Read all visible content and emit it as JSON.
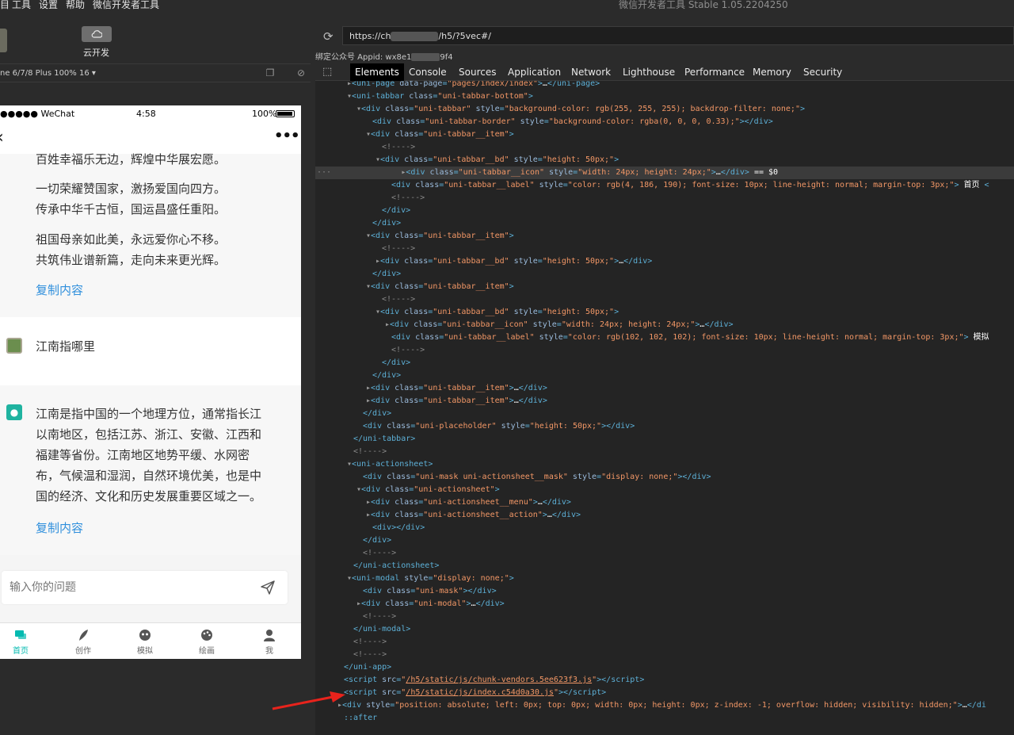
{
  "menubar": {
    "items": [
      "目",
      "工具",
      "设置",
      "帮助",
      "微信开发者工具"
    ],
    "app_title": "微信开发者工具 Stable 1.05.2204250"
  },
  "toolbar": {
    "cloud_label": "云开发"
  },
  "device": {
    "label": "ne 6/7/8 Plus 100% 16 ▾"
  },
  "phone": {
    "status": {
      "signal": "●●●●● WeChat",
      "time": "4:58",
      "battery": "100%"
    },
    "card1": {
      "lines": [
        "百姓幸福乐无边，辉煌中华展宏愿。",
        "一切荣耀赞国家，激扬爱国向四方。",
        "传承中华千古恒，国运昌盛任重阳。",
        "祖国母亲如此美，永远爱你心不移。",
        "共筑伟业谱新篇，走向未来更光辉。"
      ],
      "copy": "复制内容"
    },
    "question": {
      "text": "江南指哪里"
    },
    "answer": {
      "lines": [
        "江南是指中国的一个地理方位，通常指长江",
        "以南地区，包括江苏、浙江、安徽、江西和",
        "福建等省份。江南地区地势平缓、水网密",
        "布，气候温和湿润，自然环境优美，也是中",
        "国的经济、文化和历史发展重要区域之一。"
      ],
      "copy": "复制内容"
    },
    "input": {
      "placeholder": "输入你的问题"
    },
    "tabs": [
      {
        "label": "首页",
        "icon": "chat-icon"
      },
      {
        "label": "创作",
        "icon": "feather-icon"
      },
      {
        "label": "模拟",
        "icon": "mask-icon"
      },
      {
        "label": "绘画",
        "icon": "palette-icon"
      },
      {
        "label": "我",
        "icon": "user-icon"
      }
    ],
    "accent": "#04bab0"
  },
  "devtools": {
    "url_prefix": "https://ch",
    "url_suffix": "/h5/?5vec#/",
    "appid_prefix": "绑定公众号 Appid: wx8e1",
    "appid_suffix": "9f4",
    "tabs": [
      "Elements",
      "Console",
      "Sources",
      "Application",
      "Network",
      "Lighthouse",
      "Performance",
      "Memory",
      "Security"
    ],
    "active_tab": "Elements"
  }
}
